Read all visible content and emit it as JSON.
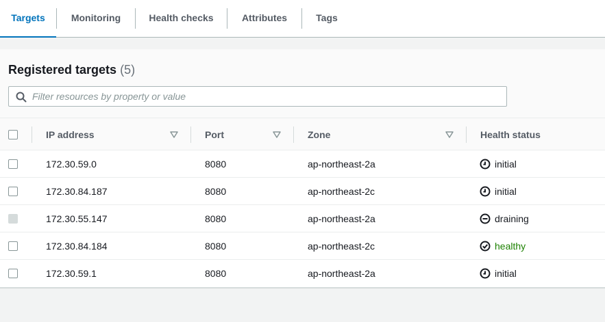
{
  "tabs": [
    {
      "label": "Targets",
      "active": true
    },
    {
      "label": "Monitoring",
      "active": false
    },
    {
      "label": "Health checks",
      "active": false
    },
    {
      "label": "Attributes",
      "active": false
    },
    {
      "label": "Tags",
      "active": false
    }
  ],
  "panel": {
    "title": "Registered targets",
    "count": "(5)",
    "search_placeholder": "Filter resources by property or value"
  },
  "table": {
    "columns": [
      "IP address",
      "Port",
      "Zone",
      "Health status"
    ],
    "rows": [
      {
        "ip": "172.30.59.0",
        "port": "8080",
        "zone": "ap-northeast-2a",
        "status": "initial",
        "status_icon": "clock-icon",
        "disabled": false
      },
      {
        "ip": "172.30.84.187",
        "port": "8080",
        "zone": "ap-northeast-2c",
        "status": "initial",
        "status_icon": "clock-icon",
        "disabled": false
      },
      {
        "ip": "172.30.55.147",
        "port": "8080",
        "zone": "ap-northeast-2a",
        "status": "draining",
        "status_icon": "minus-circle-icon",
        "disabled": true
      },
      {
        "ip": "172.30.84.184",
        "port": "8080",
        "zone": "ap-northeast-2c",
        "status": "healthy",
        "status_icon": "check-circle-icon",
        "disabled": false
      },
      {
        "ip": "172.30.59.1",
        "port": "8080",
        "zone": "ap-northeast-2a",
        "status": "initial",
        "status_icon": "clock-icon",
        "disabled": false
      }
    ]
  },
  "colors": {
    "accent": "#0073bb",
    "healthy": "#1d8102",
    "text": "#16191f",
    "muted": "#545b64"
  }
}
